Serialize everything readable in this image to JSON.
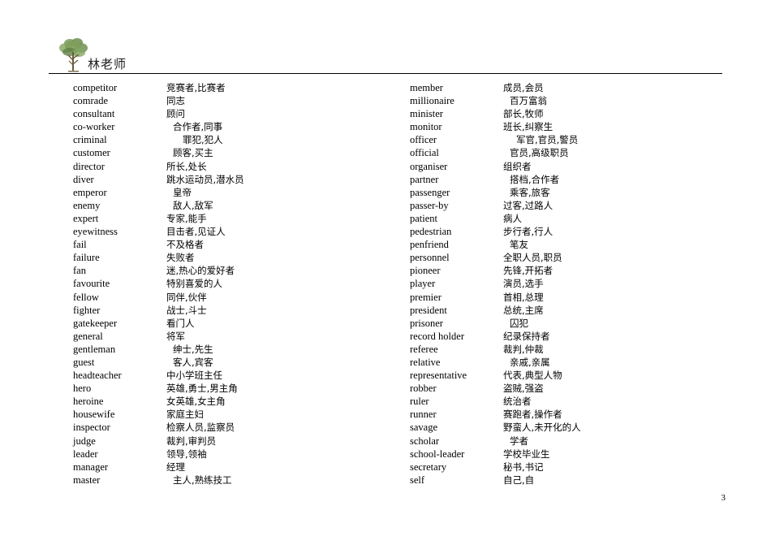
{
  "document": {
    "title": "林老师",
    "page_number": "3",
    "logo": "tree-logo"
  },
  "columns": [
    {
      "name": "left-column",
      "rows": [
        {
          "en": "competitor",
          "zh": "竞赛者,比赛者",
          "indent": 0
        },
        {
          "en": "comrade",
          "zh": "同志",
          "indent": 0
        },
        {
          "en": "consultant",
          "zh": "顾问",
          "indent": 0
        },
        {
          "en": "co-worker",
          "zh": "合作者,同事",
          "indent": 8
        },
        {
          "en": "criminal",
          "zh": "罪犯,犯人",
          "indent": 20
        },
        {
          "en": "customer",
          "zh": "顾客,买主",
          "indent": 8
        },
        {
          "en": "director",
          "zh": "所长,处长",
          "indent": 0
        },
        {
          "en": "diver",
          "zh": "跳水运动员,潜水员",
          "indent": 0
        },
        {
          "en": "emperor",
          "zh": "皇帝",
          "indent": 8
        },
        {
          "en": "enemy",
          "zh": "敌人,敌军",
          "indent": 8
        },
        {
          "en": "expert",
          "zh": "专家,能手",
          "indent": 0
        },
        {
          "en": "eyewitness",
          "zh": "目击者,见证人",
          "indent": 0
        },
        {
          "en": "fail",
          "zh": "不及格者",
          "indent": 0
        },
        {
          "en": "failure",
          "zh": "失败者",
          "indent": 0
        },
        {
          "en": "fan",
          "zh": "迷,热心的爱好者",
          "indent": 0
        },
        {
          "en": "favourite",
          "zh": "特别喜爱的人",
          "indent": 0
        },
        {
          "en": "fellow",
          "zh": "同伴,伙伴",
          "indent": 0
        },
        {
          "en": "fighter",
          "zh": "战士,斗士",
          "indent": 0
        },
        {
          "en": "gatekeeper",
          "zh": "看门人",
          "indent": 0
        },
        {
          "en": "general",
          "zh": "将军",
          "indent": 0
        },
        {
          "en": "gentleman",
          "zh": "绅士,先生",
          "indent": 8
        },
        {
          "en": "guest",
          "zh": "客人,宾客",
          "indent": 8
        },
        {
          "en": "headteacher",
          "zh": "中小学班主任",
          "indent": -8
        },
        {
          "en": "hero",
          "zh": "英雄,勇士,男主角",
          "indent": 0
        },
        {
          "en": "heroine",
          "zh": "女英雄,女主角",
          "indent": 0
        },
        {
          "en": "housewife",
          "zh": "家庭主妇",
          "indent": 0
        },
        {
          "en": "inspector",
          "zh": "检察人员,监察员",
          "indent": 0
        },
        {
          "en": "judge",
          "zh": "裁判,审判员",
          "indent": 0
        },
        {
          "en": "leader",
          "zh": "领导,领袖",
          "indent": 0
        },
        {
          "en": "manager",
          "zh": "经理",
          "indent": 0
        },
        {
          "en": "master",
          "zh": "主人,熟练技工",
          "indent": 8
        }
      ]
    },
    {
      "name": "right-column",
      "rows": [
        {
          "en": "member",
          "zh": "成员,会员",
          "indent": 0
        },
        {
          "en": "millionaire",
          "zh": "百万富翁",
          "indent": 8
        },
        {
          "en": "minister",
          "zh": "部长,牧师",
          "indent": 0
        },
        {
          "en": "monitor",
          "zh": "班长,纠察生",
          "indent": 0
        },
        {
          "en": "officer",
          "zh": "军官,官员,警员",
          "indent": 16
        },
        {
          "en": "official",
          "zh": "官员,高级职员",
          "indent": 8
        },
        {
          "en": "organiser",
          "zh": "组织者",
          "indent": 0
        },
        {
          "en": "partner",
          "zh": "搭档,合作者",
          "indent": 8
        },
        {
          "en": "passenger",
          "zh": "乘客,旅客",
          "indent": 8
        },
        {
          "en": "passer-by",
          "zh": "过客,过路人",
          "indent": 0
        },
        {
          "en": "patient",
          "zh": "病人",
          "indent": 0
        },
        {
          "en": "pedestrian",
          "zh": "步行者,行人",
          "indent": 0
        },
        {
          "en": "penfriend",
          "zh": "笔友",
          "indent": 8
        },
        {
          "en": "personnel",
          "zh": "全职人员,职员",
          "indent": 0
        },
        {
          "en": "pioneer",
          "zh": "先锋,开拓者",
          "indent": 0
        },
        {
          "en": "player",
          "zh": "演员,选手",
          "indent": 0
        },
        {
          "en": "premier",
          "zh": "首相,总理",
          "indent": 0
        },
        {
          "en": "president",
          "zh": "总统,主席",
          "indent": 0
        },
        {
          "en": "prisoner",
          "zh": "囚犯",
          "indent": 8
        },
        {
          "en": "record holder",
          "zh": "纪录保持者",
          "indent": 0
        },
        {
          "en": "referee",
          "zh": "裁判,仲裁",
          "indent": 0
        },
        {
          "en": "relative",
          "zh": "亲戚,亲属",
          "indent": 8
        },
        {
          "en": "representative",
          "zh": "代表,典型人物",
          "indent": 0
        },
        {
          "en": "robber",
          "zh": "盗贼,强盗",
          "indent": 0
        },
        {
          "en": "ruler",
          "zh": "统治者",
          "indent": 0
        },
        {
          "en": "runner",
          "zh": "赛跑者,操作者",
          "indent": 0
        },
        {
          "en": "savage",
          "zh": "野蛮人,未开化的人",
          "indent": 0
        },
        {
          "en": "scholar",
          "zh": "学者",
          "indent": 8
        },
        {
          "en": "school-leader",
          "zh": "学校毕业生",
          "indent": 0
        },
        {
          "en": "secretary",
          "zh": "秘书,书记",
          "indent": 0
        },
        {
          "en": "self",
          "zh": "自己,自",
          "indent": 0
        }
      ]
    }
  ]
}
